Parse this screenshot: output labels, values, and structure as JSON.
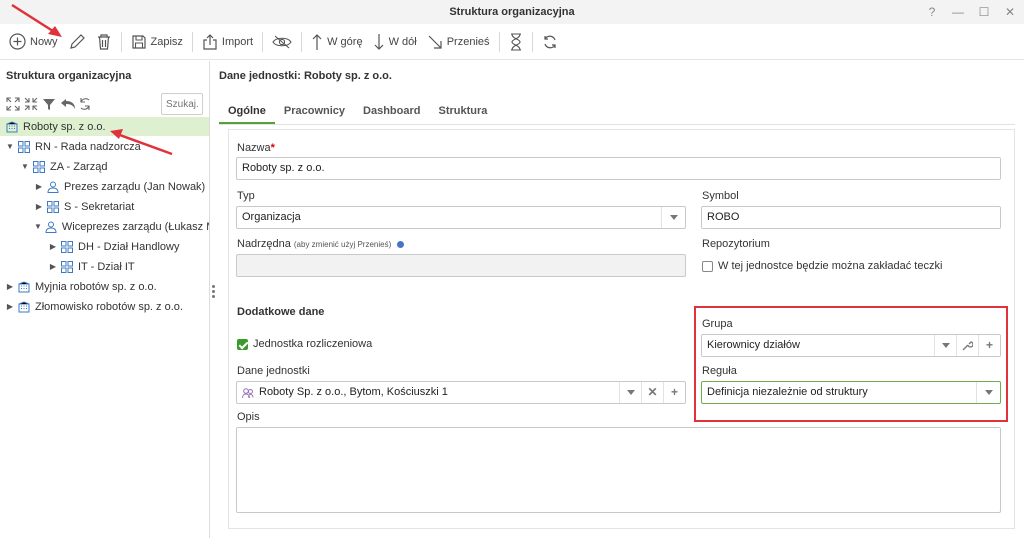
{
  "window": {
    "title": "Struktura organizacyjna",
    "controls": [
      "?",
      "—",
      "☐",
      "✕"
    ]
  },
  "toolbar": {
    "new_label": "Nowy",
    "save_label": "Zapisz",
    "import_label": "Import",
    "up_label": "W górę",
    "down_label": "W dół",
    "move_label": "Przenieś"
  },
  "left_panel": {
    "title": "Struktura organizacyjna",
    "search_placeholder": "Szukaj...",
    "tree": [
      {
        "label": "Roboty sp. z o.o.",
        "selected": true
      },
      {
        "label": "RN - Rada nadzorcza"
      },
      {
        "label": "ZA - Zarząd"
      },
      {
        "label": "Prezes zarządu (Jan Nowak)"
      },
      {
        "label": "S - Sekretariat"
      },
      {
        "label": "Wiceprezes zarządu (Łukasz Mą"
      },
      {
        "label": "DH - Dział Handlowy"
      },
      {
        "label": "IT - Dział IT"
      },
      {
        "label": "Myjnia robotów sp. z o.o."
      },
      {
        "label": "Złomowisko robotów sp. z o.o."
      }
    ]
  },
  "main": {
    "header": "Dane jednostki: Roboty sp. z o.o.",
    "tabs": [
      {
        "label": "Ogólne",
        "active": true
      },
      {
        "label": "Pracownicy"
      },
      {
        "label": "Dashboard"
      },
      {
        "label": "Struktura"
      }
    ],
    "form": {
      "nazwa_label": "Nazwa",
      "nazwa_value": "Roboty sp. z o.o.",
      "typ_label": "Typ",
      "typ_value": "Organizacja",
      "symbol_label": "Symbol",
      "symbol_value": "ROBO",
      "nadrzedna_label": "Nadrzędna",
      "nadrzedna_note": "(aby zmienić użyj Przenieś)",
      "nadrzedna_value": "",
      "repo_label": "Repozytorium",
      "repo_checkbox": "W tej jednostce będzie można zakładać teczki",
      "repo_checked": false,
      "dodatkowe_title": "Dodatkowe dane",
      "rozliczeniowa_label": "Jednostka rozliczeniowa",
      "rozliczeniowa_checked": true,
      "dane_label": "Dane jednostki",
      "dane_value": "Roboty Sp. z o.o., Bytom, Kościuszki 1",
      "grupa_label": "Grupa",
      "grupa_value": "Kierownicy działów",
      "regula_label": "Reguła",
      "regula_value": "Definicja niezależnie od struktury",
      "opis_label": "Opis",
      "opis_value": ""
    }
  },
  "colors": {
    "accent": "#5a9e3a",
    "highlight_box": "#e0323a",
    "selected_row": "#dff0d0"
  }
}
